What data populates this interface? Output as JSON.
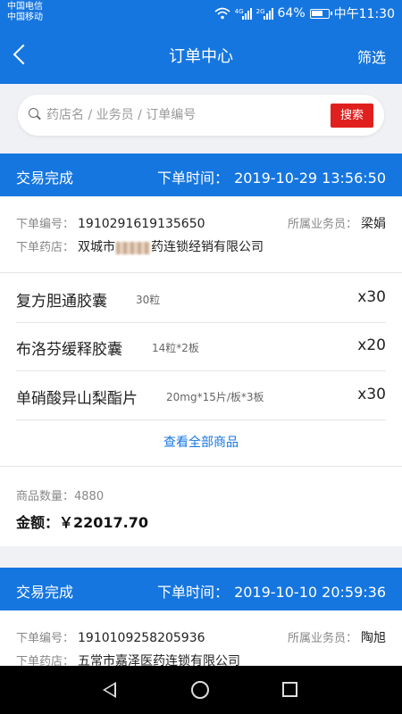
{
  "status_bar": {
    "carrier_1": "中国电信",
    "carrier_2": "中国移动",
    "net_1": "4G",
    "net_2": "2G",
    "battery": "64%",
    "time": "中午11:30"
  },
  "header": {
    "title": "订单中心",
    "filter_label": "筛选"
  },
  "search": {
    "placeholder": "药店名 / 业务员 / 订单编号",
    "button_label": "搜索"
  },
  "labels": {
    "order_time": "下单时间：",
    "order_no": "下单编号：",
    "pharmacy": "下单药店：",
    "salesperson": "所属业务员：",
    "view_all": "查看全部商品",
    "count": "商品数量：",
    "amount": "金额："
  },
  "orders": [
    {
      "status": "交易完成",
      "time": "2019-10-29 13:56:50",
      "order_no": "1910291619135650",
      "salesperson": "梁娟",
      "pharmacy_prefix": "双城市",
      "pharmacy_suffix": "药连锁经销有限公司",
      "products": [
        {
          "name": "复方胆通胶囊",
          "spec": "30粒",
          "qty": "x30"
        },
        {
          "name": "布洛芬缓释胶囊",
          "spec": "14粒*2板",
          "qty": "x20"
        },
        {
          "name": "单硝酸异山梨酯片",
          "spec": "20mg*15片/板*3板",
          "qty": "x30"
        }
      ],
      "count": "4880",
      "amount": "￥22017.70"
    },
    {
      "status": "交易完成",
      "time": "2019-10-10 20:59:36",
      "order_no": "1910109258205936",
      "salesperson": "陶旭",
      "pharmacy": "五常市嘉泽医药连锁有限公司"
    }
  ],
  "colors": {
    "primary": "#1676e0",
    "search_button": "#e0201e",
    "link": "#1676e0"
  }
}
